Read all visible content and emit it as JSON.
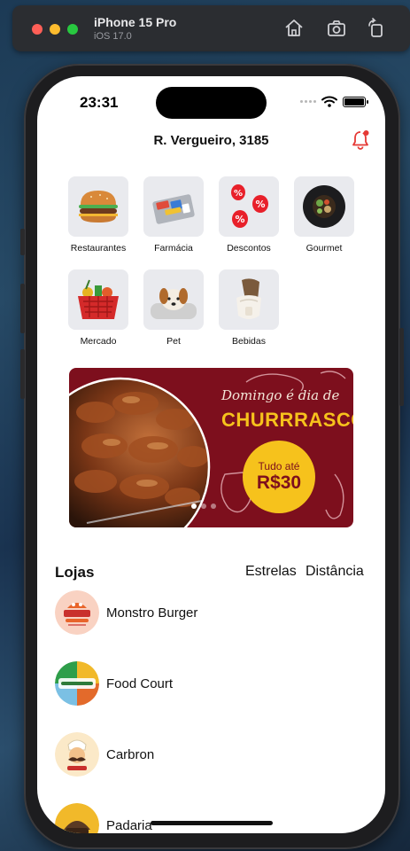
{
  "simulator": {
    "device": "iPhone 15 Pro",
    "os": "iOS 17.0",
    "buttons": [
      {
        "name": "home-icon"
      },
      {
        "name": "screenshot-icon"
      },
      {
        "name": "rotate-icon"
      }
    ]
  },
  "status_bar": {
    "time": "23:31"
  },
  "header": {
    "address": "R. Vergueiro, 3185",
    "notification_icon": "bell-icon",
    "accent_color": "#e53935"
  },
  "categories": [
    {
      "label": "Restaurantes",
      "icon": "burger-icon"
    },
    {
      "label": "Farmácia",
      "icon": "pharmacy-icon"
    },
    {
      "label": "Descontos",
      "icon": "discount-icon"
    },
    {
      "label": "Gourmet",
      "icon": "gourmet-icon"
    },
    {
      "label": "Mercado",
      "icon": "basket-icon"
    },
    {
      "label": "Pet",
      "icon": "dog-icon"
    },
    {
      "label": "Bebidas",
      "icon": "drinks-icon"
    }
  ],
  "banner": {
    "line1": "Domingo é dia de",
    "line2": "CHURRRASCO",
    "promo_top": "Tudo até",
    "promo_price": "R$30",
    "pages": 3,
    "active_page": 1,
    "colors": {
      "background": "#7d0f1d",
      "highlight": "#f6c21c"
    }
  },
  "stores_section": {
    "title": "Lojas",
    "sort_stars": "Estrelas",
    "sort_distance": "Distância",
    "items": [
      {
        "name": "Monstro Burger",
        "logo": "monstro-burger-logo"
      },
      {
        "name": "Food Court",
        "logo": "food-court-logo"
      },
      {
        "name": "Carbron",
        "logo": "carbron-logo"
      },
      {
        "name": "Padaria",
        "logo": "padaria-logo"
      }
    ]
  }
}
